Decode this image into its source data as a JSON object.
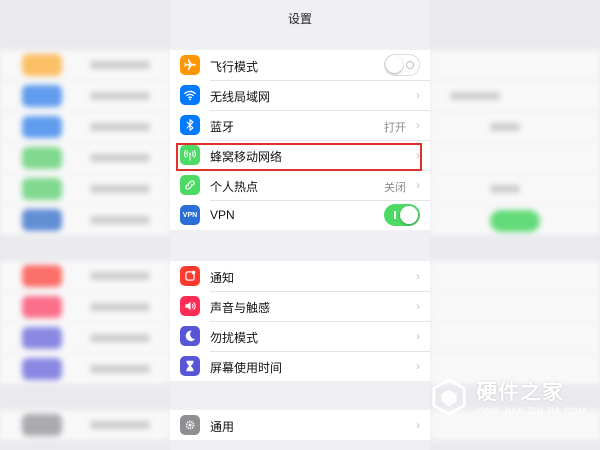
{
  "nav": {
    "title": "设置"
  },
  "settings_groups": [
    {
      "rows": [
        {
          "label": "飞行模式",
          "icon": "airplane-icon",
          "icon_color": "#ff9500",
          "accessory": "switch",
          "switch_on": false
        },
        {
          "label": "无线局域网",
          "icon": "wifi-icon",
          "icon_color": "#007aff",
          "accessory": "chevron",
          "value": ""
        },
        {
          "label": "蓝牙",
          "icon": "bluetooth-icon",
          "icon_color": "#007aff",
          "accessory": "chevron",
          "value": "打开"
        },
        {
          "label": "蜂窝移动网络",
          "icon": "cellular-icon",
          "icon_color": "#4cd964",
          "accessory": "chevron",
          "value": "",
          "highlighted": true
        },
        {
          "label": "个人热点",
          "icon": "hotspot-icon",
          "icon_color": "#4cd964",
          "accessory": "chevron",
          "value": "关闭"
        },
        {
          "label": "VPN",
          "icon": "vpn-icon",
          "icon_glyph": "VPN",
          "icon_color": "#2b6fd6",
          "accessory": "switch",
          "switch_on": true
        }
      ]
    },
    {
      "rows": [
        {
          "label": "通知",
          "icon": "notifications-icon",
          "icon_color": "#ff3b30",
          "accessory": "chevron"
        },
        {
          "label": "声音与触感",
          "icon": "sound-icon",
          "icon_color": "#ff2d55",
          "accessory": "chevron"
        },
        {
          "label": "勿扰模式",
          "icon": "moon-icon",
          "icon_color": "#5856d6",
          "accessory": "chevron"
        },
        {
          "label": "屏幕使用时间",
          "icon": "hourglass-icon",
          "icon_color": "#5856d6",
          "accessory": "chevron"
        }
      ]
    },
    {
      "rows": [
        {
          "label": "通用",
          "icon": "gear-icon",
          "icon_color": "#8e8e93",
          "accessory": "chevron"
        }
      ]
    }
  ],
  "accent_colors": {
    "highlight_border": "#e0302b",
    "switch_on": "#4cd964"
  },
  "watermark": {
    "title": "硬件之家",
    "subtitle": "YING JIAN ZHI JIA.COM"
  }
}
